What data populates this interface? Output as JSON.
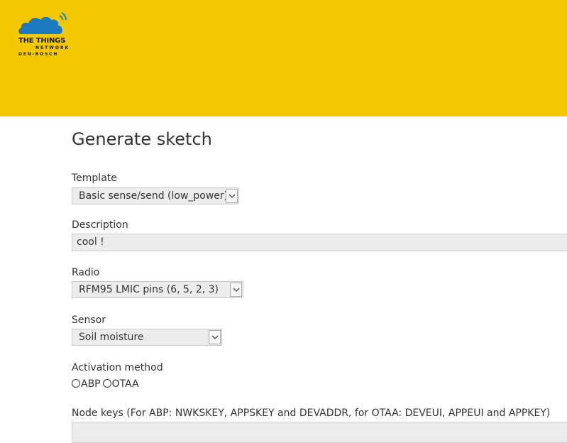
{
  "header": {
    "logo": {
      "line1": "THE THINGS",
      "line2": "NETWORK",
      "line3": "DEN-BOSCH",
      "icon": "cloud-signal-icon",
      "cloud_color": "#1c7ac2"
    },
    "background_color": "#f4c800"
  },
  "page": {
    "title": "Generate sketch"
  },
  "form": {
    "template": {
      "label": "Template",
      "selected": "Basic sense/send (low_power)"
    },
    "description": {
      "label": "Description",
      "value": "cool !"
    },
    "radio": {
      "label": "Radio",
      "selected": "RFM95 LMIC pins (6, 5, 2, 3)"
    },
    "sensor": {
      "label": "Sensor",
      "selected": "Soil moisture"
    },
    "activation": {
      "label": "Activation method",
      "options": [
        "ABP",
        "OTAA"
      ]
    },
    "node_keys": {
      "label": "Node keys (For ABP: NWKSKEY, APPSKEY and DEVADDR, for OTAA: DEVEUI, APPEUI and APPKEY)",
      "value": ""
    }
  }
}
